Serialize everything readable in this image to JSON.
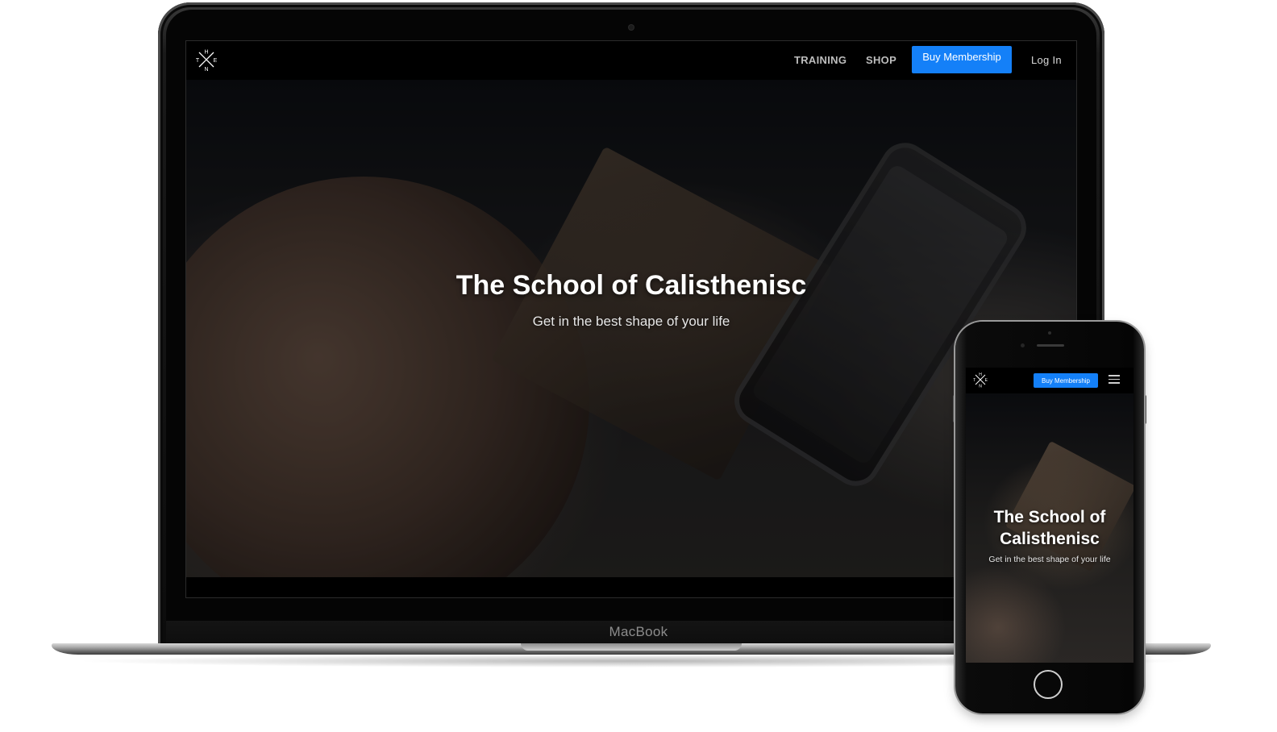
{
  "laptop": {
    "brand_label": "MacBook",
    "nav": {
      "logo_letters": {
        "top": "H",
        "left": "T",
        "right": "E",
        "bottom": "N"
      },
      "links": {
        "training": "TRAINING",
        "shop": "SHOP",
        "login": "Log In"
      },
      "cta": "Buy Membership"
    },
    "hero": {
      "title": "The School of Calisthenisc",
      "subtitle": "Get in the best shape of your life"
    }
  },
  "phone": {
    "nav": {
      "logo_letters": {
        "top": "H",
        "left": "T",
        "right": "E",
        "bottom": "N"
      },
      "cta": "Buy Membership",
      "menu_icon": "hamburger-icon"
    },
    "hero": {
      "title": "The School of Calisthenisc",
      "subtitle": "Get in the best shape of your life"
    }
  },
  "colors": {
    "accent": "#1480f8",
    "nav_background": "#000000",
    "hero_text": "#ffffff"
  }
}
